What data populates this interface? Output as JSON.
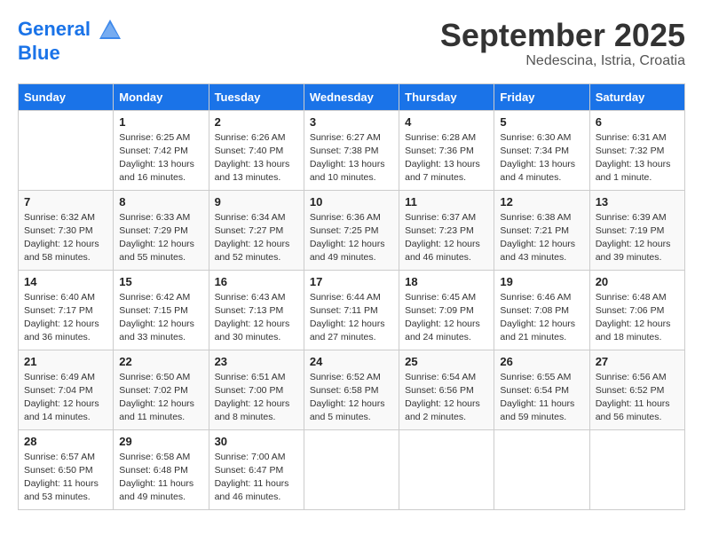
{
  "header": {
    "logo_line1": "General",
    "logo_line2": "Blue",
    "month": "September 2025",
    "location": "Nedescina, Istria, Croatia"
  },
  "days_of_week": [
    "Sunday",
    "Monday",
    "Tuesday",
    "Wednesday",
    "Thursday",
    "Friday",
    "Saturday"
  ],
  "weeks": [
    [
      {
        "day": "",
        "info": ""
      },
      {
        "day": "1",
        "info": "Sunrise: 6:25 AM\nSunset: 7:42 PM\nDaylight: 13 hours\nand 16 minutes."
      },
      {
        "day": "2",
        "info": "Sunrise: 6:26 AM\nSunset: 7:40 PM\nDaylight: 13 hours\nand 13 minutes."
      },
      {
        "day": "3",
        "info": "Sunrise: 6:27 AM\nSunset: 7:38 PM\nDaylight: 13 hours\nand 10 minutes."
      },
      {
        "day": "4",
        "info": "Sunrise: 6:28 AM\nSunset: 7:36 PM\nDaylight: 13 hours\nand 7 minutes."
      },
      {
        "day": "5",
        "info": "Sunrise: 6:30 AM\nSunset: 7:34 PM\nDaylight: 13 hours\nand 4 minutes."
      },
      {
        "day": "6",
        "info": "Sunrise: 6:31 AM\nSunset: 7:32 PM\nDaylight: 13 hours\nand 1 minute."
      }
    ],
    [
      {
        "day": "7",
        "info": "Sunrise: 6:32 AM\nSunset: 7:30 PM\nDaylight: 12 hours\nand 58 minutes."
      },
      {
        "day": "8",
        "info": "Sunrise: 6:33 AM\nSunset: 7:29 PM\nDaylight: 12 hours\nand 55 minutes."
      },
      {
        "day": "9",
        "info": "Sunrise: 6:34 AM\nSunset: 7:27 PM\nDaylight: 12 hours\nand 52 minutes."
      },
      {
        "day": "10",
        "info": "Sunrise: 6:36 AM\nSunset: 7:25 PM\nDaylight: 12 hours\nand 49 minutes."
      },
      {
        "day": "11",
        "info": "Sunrise: 6:37 AM\nSunset: 7:23 PM\nDaylight: 12 hours\nand 46 minutes."
      },
      {
        "day": "12",
        "info": "Sunrise: 6:38 AM\nSunset: 7:21 PM\nDaylight: 12 hours\nand 43 minutes."
      },
      {
        "day": "13",
        "info": "Sunrise: 6:39 AM\nSunset: 7:19 PM\nDaylight: 12 hours\nand 39 minutes."
      }
    ],
    [
      {
        "day": "14",
        "info": "Sunrise: 6:40 AM\nSunset: 7:17 PM\nDaylight: 12 hours\nand 36 minutes."
      },
      {
        "day": "15",
        "info": "Sunrise: 6:42 AM\nSunset: 7:15 PM\nDaylight: 12 hours\nand 33 minutes."
      },
      {
        "day": "16",
        "info": "Sunrise: 6:43 AM\nSunset: 7:13 PM\nDaylight: 12 hours\nand 30 minutes."
      },
      {
        "day": "17",
        "info": "Sunrise: 6:44 AM\nSunset: 7:11 PM\nDaylight: 12 hours\nand 27 minutes."
      },
      {
        "day": "18",
        "info": "Sunrise: 6:45 AM\nSunset: 7:09 PM\nDaylight: 12 hours\nand 24 minutes."
      },
      {
        "day": "19",
        "info": "Sunrise: 6:46 AM\nSunset: 7:08 PM\nDaylight: 12 hours\nand 21 minutes."
      },
      {
        "day": "20",
        "info": "Sunrise: 6:48 AM\nSunset: 7:06 PM\nDaylight: 12 hours\nand 18 minutes."
      }
    ],
    [
      {
        "day": "21",
        "info": "Sunrise: 6:49 AM\nSunset: 7:04 PM\nDaylight: 12 hours\nand 14 minutes."
      },
      {
        "day": "22",
        "info": "Sunrise: 6:50 AM\nSunset: 7:02 PM\nDaylight: 12 hours\nand 11 minutes."
      },
      {
        "day": "23",
        "info": "Sunrise: 6:51 AM\nSunset: 7:00 PM\nDaylight: 12 hours\nand 8 minutes."
      },
      {
        "day": "24",
        "info": "Sunrise: 6:52 AM\nSunset: 6:58 PM\nDaylight: 12 hours\nand 5 minutes."
      },
      {
        "day": "25",
        "info": "Sunrise: 6:54 AM\nSunset: 6:56 PM\nDaylight: 12 hours\nand 2 minutes."
      },
      {
        "day": "26",
        "info": "Sunrise: 6:55 AM\nSunset: 6:54 PM\nDaylight: 11 hours\nand 59 minutes."
      },
      {
        "day": "27",
        "info": "Sunrise: 6:56 AM\nSunset: 6:52 PM\nDaylight: 11 hours\nand 56 minutes."
      }
    ],
    [
      {
        "day": "28",
        "info": "Sunrise: 6:57 AM\nSunset: 6:50 PM\nDaylight: 11 hours\nand 53 minutes."
      },
      {
        "day": "29",
        "info": "Sunrise: 6:58 AM\nSunset: 6:48 PM\nDaylight: 11 hours\nand 49 minutes."
      },
      {
        "day": "30",
        "info": "Sunrise: 7:00 AM\nSunset: 6:47 PM\nDaylight: 11 hours\nand 46 minutes."
      },
      {
        "day": "",
        "info": ""
      },
      {
        "day": "",
        "info": ""
      },
      {
        "day": "",
        "info": ""
      },
      {
        "day": "",
        "info": ""
      }
    ]
  ]
}
